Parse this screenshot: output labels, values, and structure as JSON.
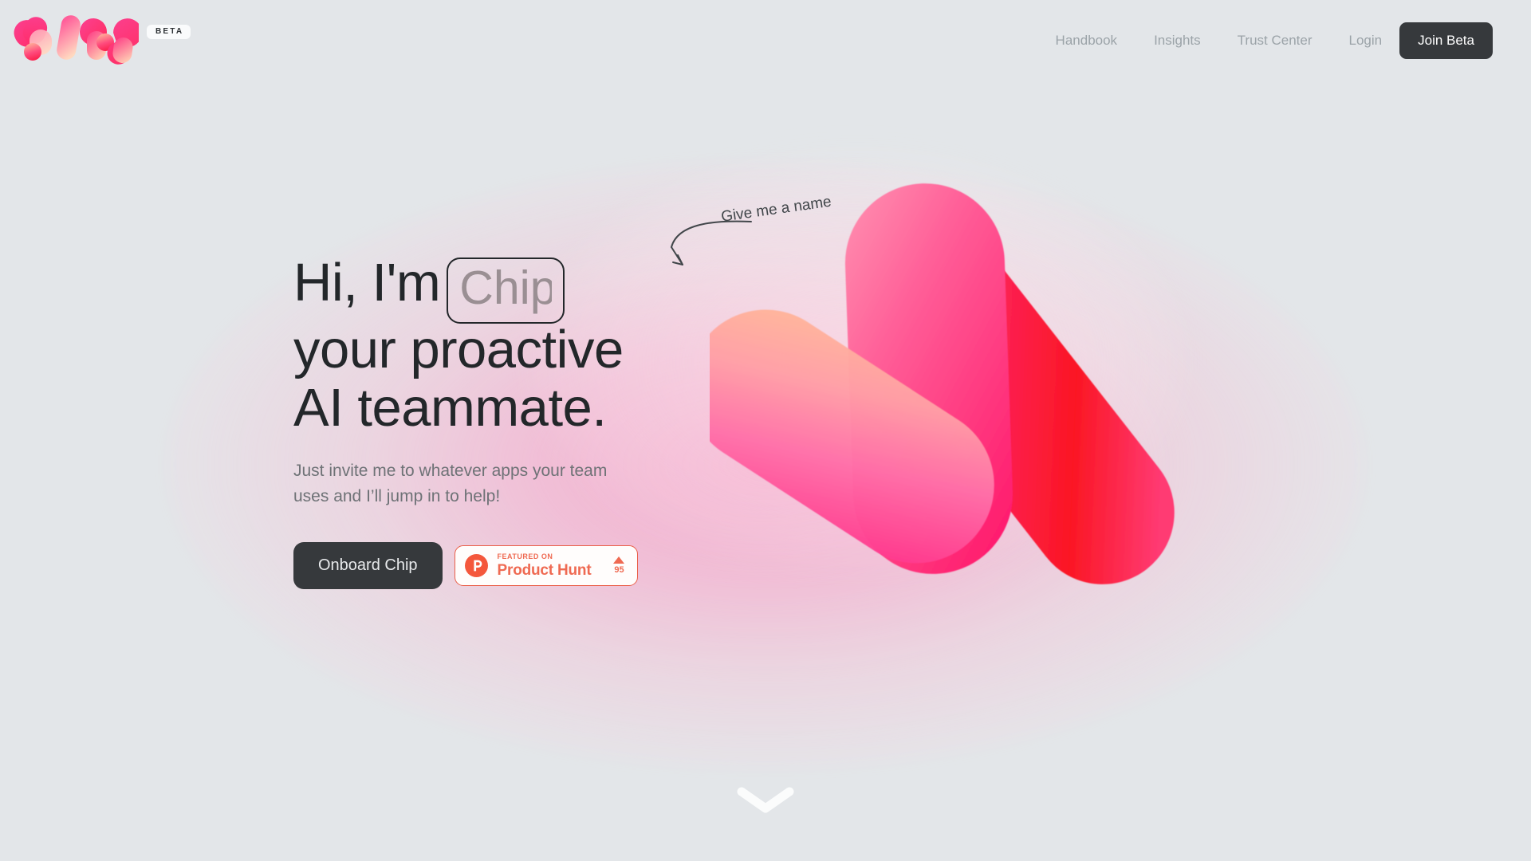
{
  "brand": {
    "logo_name": "chip-logo-mark",
    "beta_label": "BETA"
  },
  "nav": {
    "links": [
      {
        "label": "Handbook"
      },
      {
        "label": "Insights"
      },
      {
        "label": "Trust Center"
      }
    ],
    "login_label": "Login",
    "cta_label": "Join Beta"
  },
  "hero": {
    "annotation": "Give me a name",
    "headline_prefix": "Hi, I'm",
    "name_input_placeholder": "Chip",
    "name_input_value": "",
    "headline_line2": "your proactive",
    "headline_line3": "AI teammate.",
    "subhead": "Just invite me to whatever apps your team uses and I’ll jump in to help!",
    "primary_cta": "Onboard Chip"
  },
  "product_hunt": {
    "featured_on": "FEATURED ON",
    "name": "Product Hunt",
    "upvotes": "95",
    "logo_letter": "P"
  },
  "scroll_cue": {
    "icon": "chevron-down-icon"
  },
  "colors": {
    "page_background": "#e3e6e9",
    "dark_button": "#36393c",
    "headline_text": "#23272a",
    "muted_text": "#9ba3a8",
    "subhead_text": "#6e7276",
    "product_hunt": "#ef6a52",
    "accent_pink": "#fb3f8f",
    "accent_red": "#fc2030",
    "accent_peach": "#ffc0a6"
  }
}
